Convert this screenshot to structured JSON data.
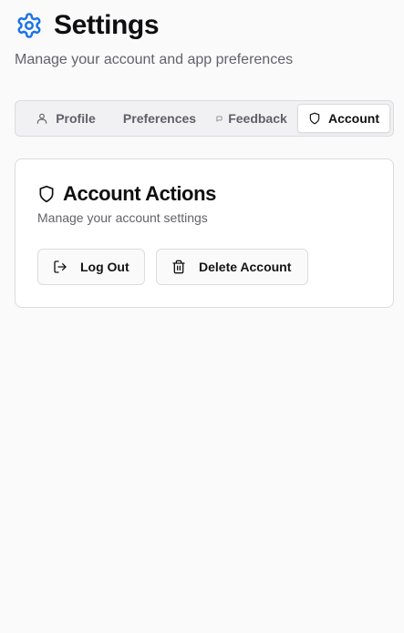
{
  "header": {
    "title": "Settings",
    "subtitle": "Manage your account and app preferences"
  },
  "tabs": [
    {
      "label": "Profile",
      "icon": "user-icon",
      "active": false
    },
    {
      "label": "Preferences",
      "icon": "",
      "active": false
    },
    {
      "label": "Feedback",
      "icon": "message-icon",
      "active": false
    },
    {
      "label": "Account",
      "icon": "shield-icon",
      "active": true
    }
  ],
  "card": {
    "title": "Account Actions",
    "description": "Manage your account settings",
    "buttons": {
      "logout_label": "Log Out",
      "delete_label": "Delete Account"
    }
  },
  "colors": {
    "accent": "#1a73e8",
    "background": "#fafafa",
    "border": "#dcdce0",
    "muted_text": "#62626b"
  }
}
